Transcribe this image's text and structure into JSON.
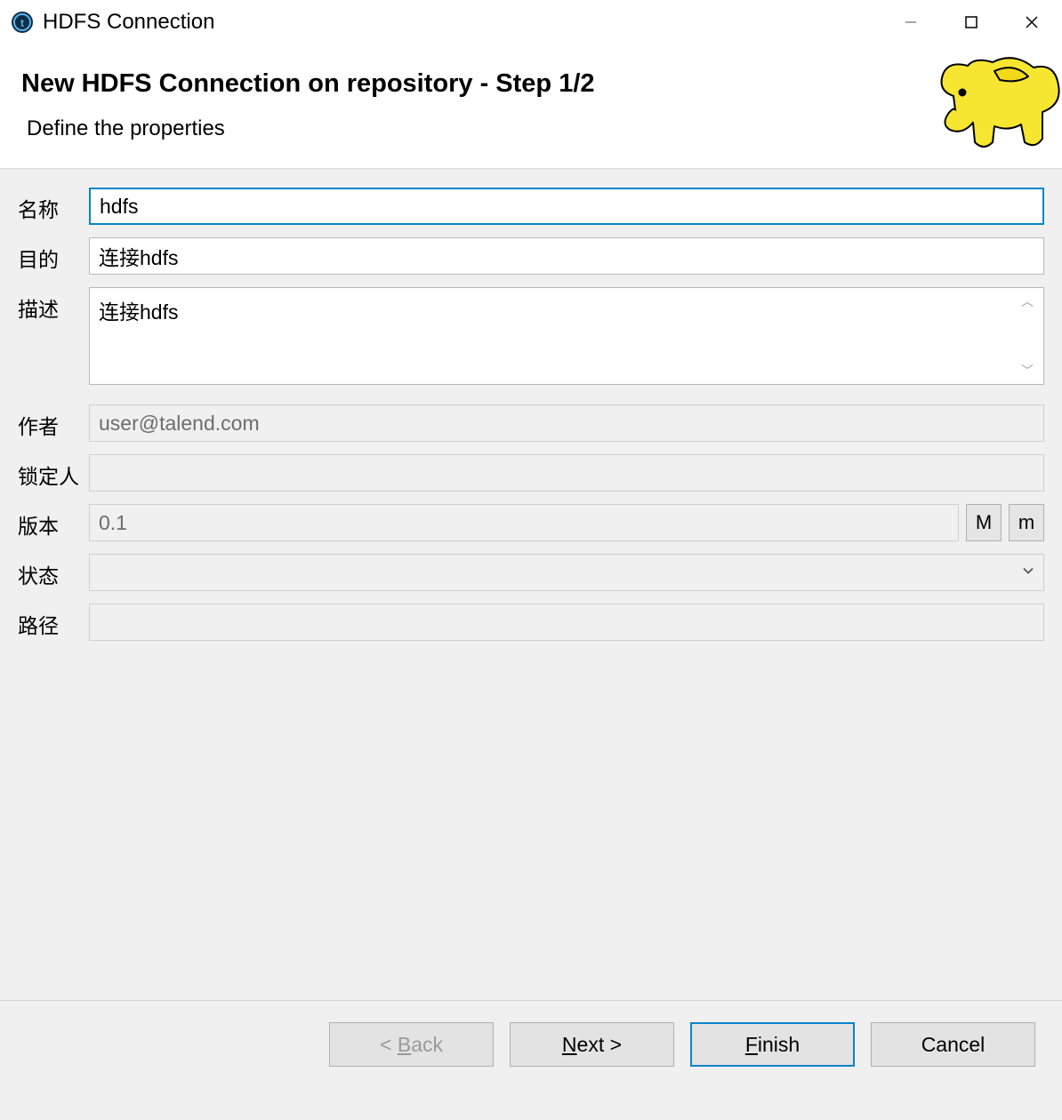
{
  "titlebar": {
    "title": "HDFS Connection"
  },
  "header": {
    "title": "New HDFS Connection on repository - Step 1/2",
    "subtitle": "Define the properties"
  },
  "form": {
    "name": {
      "label": "名称",
      "value": "hdfs"
    },
    "purpose": {
      "label": "目的",
      "value": "连接hdfs"
    },
    "desc": {
      "label": "描述",
      "value": "连接hdfs"
    },
    "author": {
      "label": "作者",
      "value": "user@talend.com"
    },
    "locker": {
      "label": "锁定人",
      "value": ""
    },
    "version": {
      "label": "版本",
      "value": "0.1",
      "major_btn": "M",
      "minor_btn": "m"
    },
    "status": {
      "label": "状态",
      "value": ""
    },
    "path": {
      "label": "路径",
      "value": ""
    }
  },
  "footer": {
    "back": "< Back",
    "next": "Next >",
    "finish": "Finish",
    "cancel": "Cancel",
    "mnemonics": {
      "back": "B",
      "next": "N",
      "finish": "F"
    }
  }
}
